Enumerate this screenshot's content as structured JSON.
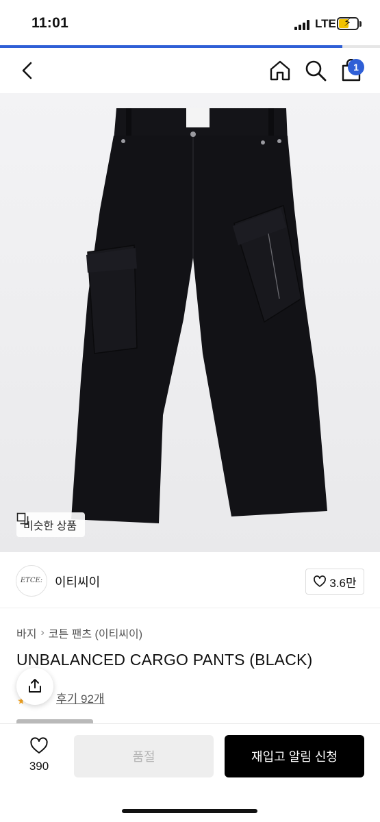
{
  "status_bar": {
    "time": "11:01",
    "network": "LTE",
    "battery_percent": 55,
    "battery_charging": true,
    "signal_bars": 4
  },
  "page_load_progress": 0.9,
  "nav": {
    "back_icon": "chevron-left-icon",
    "home_icon": "home-icon",
    "search_icon": "search-icon",
    "cart_icon": "shopping-bag-icon",
    "cart_badge": "1",
    "badge_color": "#2f5fd6"
  },
  "hero": {
    "image_subject": "black cargo pants",
    "similar_button_label": "비슷한 상품",
    "similar_icon": "copy-icon"
  },
  "brand": {
    "logo_text": "ETCE:",
    "name": "이티씨이",
    "like_icon": "heart-icon",
    "like_count": "3.6만"
  },
  "breadcrumb": [
    "바지",
    "코튼 팬츠 (이티씨이)"
  ],
  "product": {
    "title": "UNBALANCED CARGO PANTS (BLACK)",
    "review_link": "후기 92개",
    "share_icon": "share-icon"
  },
  "bottom_bar": {
    "wish_icon": "heart-icon",
    "wish_count": "390",
    "soldout_label": "품절",
    "restock_label": "재입고 알림 신청"
  }
}
